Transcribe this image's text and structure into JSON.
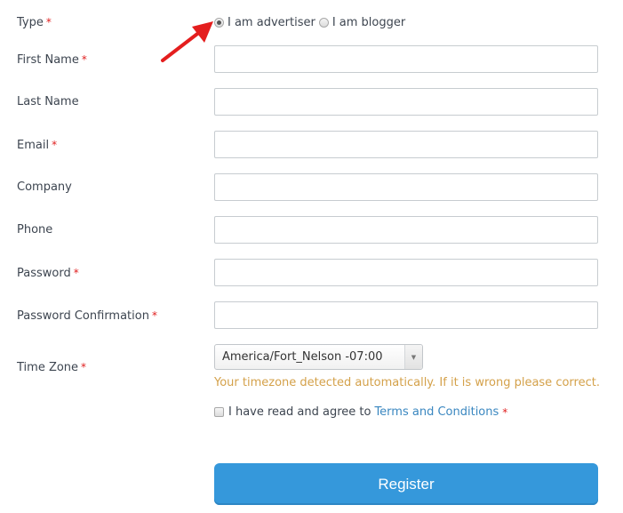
{
  "form": {
    "required_marker": "*",
    "type": {
      "label": "Type",
      "required": true,
      "options": [
        {
          "label": "I am advertiser",
          "checked": true
        },
        {
          "label": "I am blogger",
          "checked": false
        }
      ]
    },
    "fields": [
      {
        "label": "First Name",
        "required": true,
        "value": "",
        "placeholder": ""
      },
      {
        "label": "Last Name",
        "required": false,
        "value": "",
        "placeholder": ""
      },
      {
        "label": "Email",
        "required": true,
        "value": "",
        "placeholder": ""
      },
      {
        "label": "Company",
        "required": false,
        "value": "",
        "placeholder": ""
      },
      {
        "label": "Phone",
        "required": false,
        "value": "",
        "placeholder": ""
      },
      {
        "label": "Password",
        "required": true,
        "value": "",
        "placeholder": ""
      },
      {
        "label": "Password Confirmation",
        "required": true,
        "value": "",
        "placeholder": ""
      }
    ],
    "timezone": {
      "label": "Time Zone",
      "required": true,
      "selected": "America/Fort_Nelson -07:00",
      "hint": "Your timezone detected automatically. If it is wrong please correct."
    },
    "agree": {
      "text": "I have read and agree to",
      "link": "Terms and Conditions",
      "checked": false,
      "required": true
    },
    "submit_label": "Register"
  },
  "annotation": {
    "icon": "red-arrow-icon",
    "color": "#e41e1e"
  },
  "colors": {
    "accent": "#3598db",
    "required": "#e02020",
    "hint": "#d4a14a",
    "link": "#3a87c0"
  }
}
